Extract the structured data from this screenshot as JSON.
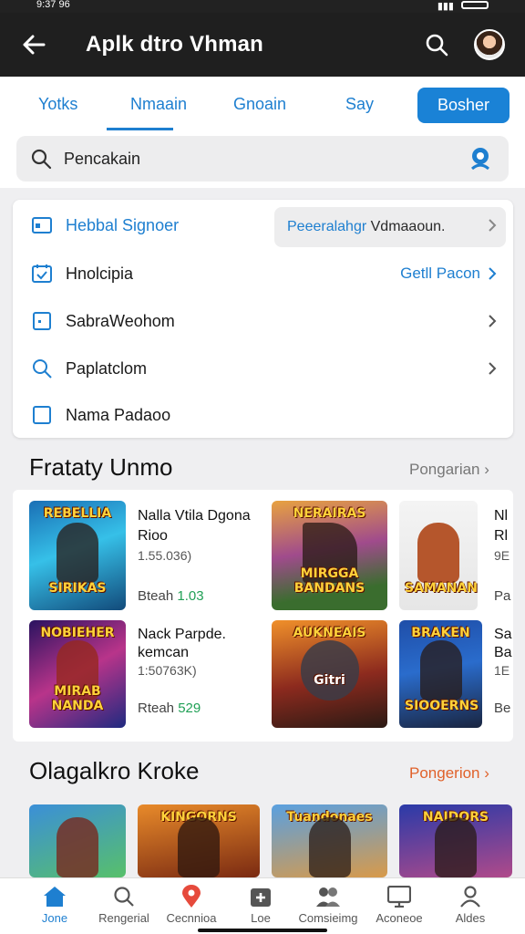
{
  "status": {
    "time": "9:37 96",
    "right": "il"
  },
  "appbar": {
    "title": "Aplk dtro Vhman",
    "back_icon": "arrow-left-icon",
    "search_icon": "search-icon"
  },
  "tabs": [
    {
      "label": "Yotks"
    },
    {
      "label": "Nmaain"
    },
    {
      "label": "Gnoain"
    },
    {
      "label": "Say"
    }
  ],
  "tab_button": {
    "label": "Bosher"
  },
  "search": {
    "text": "Pencakain"
  },
  "menu": {
    "items": [
      {
        "label": "Hebbal Signoer",
        "pill_left": "Peeeralahgr",
        "pill_right": " Vdmaaoun."
      },
      {
        "label": "Hnolcipia",
        "right": "Getll Pacon"
      },
      {
        "label": "SabraWeohom"
      },
      {
        "label": "Paplatclom"
      },
      {
        "label": "Nama Padaoo"
      }
    ]
  },
  "section1": {
    "title": "Frataty Unmo",
    "link": "Pongarian"
  },
  "games1": [
    {
      "caption_top": "REBELLIA",
      "caption_bottom": "SIRIKAS",
      "title_1": "Nalla Vtila Dgona",
      "title_2": "Rioo",
      "sub": "1.55.036)",
      "score_label": "Bteah",
      "score": "1.03"
    },
    {
      "caption_top": "NERAIRAS",
      "caption_bottom": "MIRGGA BANDANS",
      "title_1": "",
      "title_2": "",
      "sub": "",
      "score_label": "",
      "score": ""
    },
    {
      "caption_top": "",
      "caption_bottom": "SAMANAN",
      "title_1": "Nl",
      "title_2": "Rl",
      "sub": "9E",
      "score_label": "Pa",
      "score": ""
    },
    {
      "caption_top": "NOBIEHER",
      "caption_bottom": "MIRAB NANDA",
      "title_1": "Nack Parpde.",
      "title_2": "kemcan",
      "sub": "1:50763K)",
      "score_label": "Rteah",
      "score": "529"
    },
    {
      "caption_top": "AUKNEAIS",
      "caption_bottom": "Gitri",
      "title_1": "",
      "title_2": "",
      "sub": "",
      "score_label": "",
      "score": ""
    },
    {
      "caption_top": "BRAKEN",
      "caption_bottom": "SIOOERNS",
      "title_1": "Sa",
      "title_2": "Ba",
      "sub": "1E",
      "score_label": "Be",
      "score": ""
    }
  ],
  "section2": {
    "title": "Olagalkro Kroke",
    "link": "Pongerion"
  },
  "games2": [
    {
      "caption_top": ""
    },
    {
      "caption_top": "KINGORNS"
    },
    {
      "caption_top": "Tuandonaes"
    },
    {
      "caption_top": "NAIDORS"
    }
  ],
  "bottom_nav": [
    {
      "label": "Jone",
      "icon": "home-icon"
    },
    {
      "label": "Rengerial",
      "icon": "search-icon"
    },
    {
      "label": "Cecnnioa",
      "icon": "location-pin-icon"
    },
    {
      "label": "Loe",
      "icon": "medical-kit-icon"
    },
    {
      "label": "Comsieimg",
      "icon": "people-icon"
    },
    {
      "label": "Aconeoe",
      "icon": "monitor-icon"
    },
    {
      "label": "Aldes",
      "icon": "person-icon"
    }
  ],
  "colors": {
    "accent": "#1e7fd0",
    "appbar": "#1f1f1f",
    "orange_link": "#e0612a",
    "score_green": "#21a056"
  }
}
